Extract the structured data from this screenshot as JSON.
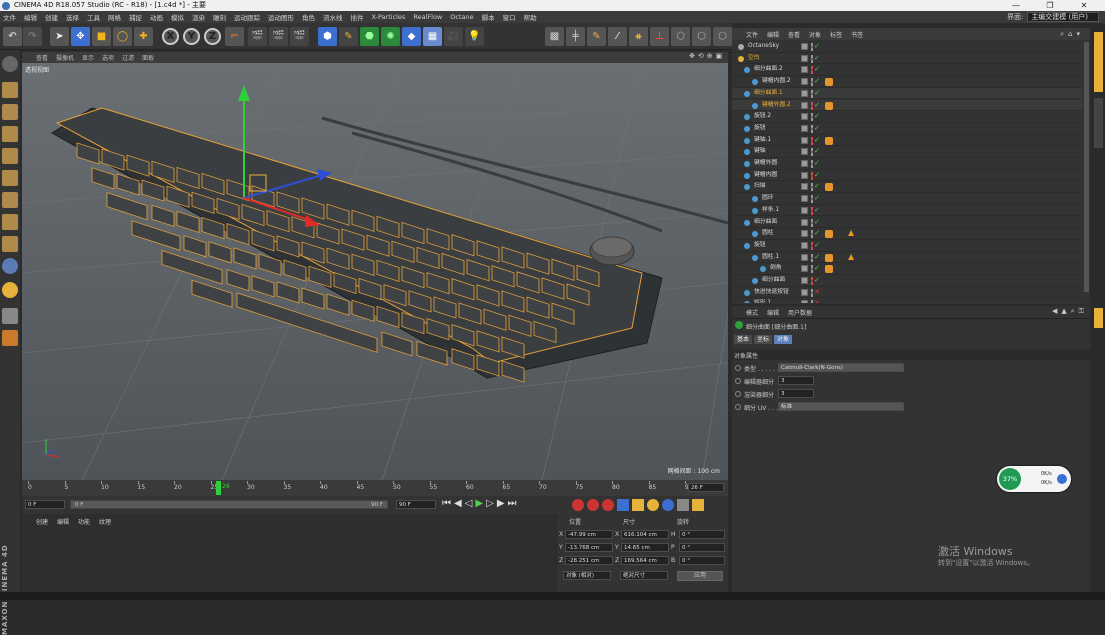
{
  "window": {
    "title": "CINEMA 4D R18.057 Studio (RC - R18) - [1.c4d *] - 主要",
    "btn_min": "—",
    "btn_max": "❐",
    "btn_close": "✕"
  },
  "menubar": [
    "文件",
    "编辑",
    "创建",
    "选择",
    "工具",
    "网格",
    "捕捉",
    "动画",
    "模拟",
    "渲染",
    "雕刻",
    "运动跟踪",
    "运动图形",
    "角色",
    "流水线",
    "插件",
    "X-Particles",
    "RealFlow",
    "Octane",
    "脚本",
    "窗口",
    "帮助"
  ],
  "layout": {
    "label": "界面:",
    "value": "主编交建模 (用户)"
  },
  "toolbar_icons": [
    "undo-icon",
    "redo-icon",
    "select-arrow-icon",
    "move-icon",
    "scale-icon",
    "rotate-icon",
    "live-select-icon",
    "x-axis-icon",
    "y-axis-icon",
    "z-axis-icon",
    "coord-system-icon",
    "render-view-icon",
    "render-picture-icon",
    "render-settings-icon",
    "cube-icon",
    "pen-icon",
    "subdivision-icon",
    "array-icon",
    "floor-icon",
    "deformer-icon",
    "camera-icon",
    "light-icon"
  ],
  "toolbar_axis": {
    "x": "X",
    "y": "Y",
    "z": "Z"
  },
  "viewport": {
    "menu": [
      "查看",
      "摄像机",
      "显示",
      "选项",
      "过滤",
      "面板"
    ],
    "label": "透视视图",
    "grid_spacing": "网格间距 : 100 cm"
  },
  "timeline": {
    "ticks": [
      "0",
      "5",
      "10",
      "15",
      "20",
      "25",
      "30",
      "35",
      "40",
      "45",
      "50",
      "55",
      "60",
      "65",
      "70",
      "75",
      "80",
      "85",
      "90"
    ],
    "current_frame": "26",
    "frame_field": "26 F"
  },
  "transport": {
    "start": "0 F",
    "slider_start": "0 F",
    "slider_end": "90 F",
    "end": "90 F"
  },
  "material_panel": {
    "menu": [
      "创建",
      "编辑",
      "功能",
      "纹理"
    ]
  },
  "brand": {
    "vertical_text": "MAXON CINEMA 4D"
  },
  "coords": {
    "headers": {
      "position": "位置",
      "size": "尺寸",
      "rotation": "旋转"
    },
    "rows": [
      {
        "axis": "X",
        "pos": "-47.99 cm",
        "size_axis": "X",
        "size": "616.104 cm",
        "rot_axis": "H",
        "rot": "0 °"
      },
      {
        "axis": "Y",
        "pos": "-13.768 cm",
        "size_axis": "Y",
        "size": "14.65 cm",
        "rot_axis": "P",
        "rot": "0 °"
      },
      {
        "axis": "Z",
        "pos": "-28.251 cm",
        "size_axis": "Z",
        "size": "169.564 cm",
        "rot_axis": "B",
        "rot": "0 °"
      }
    ],
    "mode1": "对象 (相对)",
    "mode2": "绝对尺寸",
    "apply": "应用"
  },
  "object_manager": {
    "menu": [
      "文件",
      "编辑",
      "查看",
      "对象",
      "标签",
      "书签"
    ],
    "objects": [
      {
        "name": "OctaneSky",
        "color": "#d8d8d8"
      },
      {
        "name": "空白",
        "color": "#e6b23a"
      },
      {
        "name": "细分曲面.2",
        "color": "#d8d8d8"
      },
      {
        "name": "键帽内圆.2",
        "color": "#d8d8d8"
      },
      {
        "name": "细分曲面.1",
        "color": "#e6b23a"
      },
      {
        "name": "键帽外圆.2",
        "color": "#e6b23a"
      },
      {
        "name": "旋钮.2",
        "color": "#d8d8d8"
      },
      {
        "name": "旋钮",
        "color": "#d8d8d8"
      },
      {
        "name": "键轴.1",
        "color": "#d8d8d8"
      },
      {
        "name": "键轴",
        "color": "#d8d8d8"
      },
      {
        "name": "键帽外圆",
        "color": "#d8d8d8"
      },
      {
        "name": "键帽内圆",
        "color": "#d8d8d8"
      },
      {
        "name": "扫描",
        "color": "#d8d8d8"
      },
      {
        "name": "圆环",
        "color": "#d8d8d8"
      },
      {
        "name": "样条.1",
        "color": "#d8d8d8"
      },
      {
        "name": "细分曲面",
        "color": "#d8d8d8"
      },
      {
        "name": "圆柱",
        "color": "#d8d8d8"
      },
      {
        "name": "旋钮",
        "color": "#d8d8d8"
      },
      {
        "name": "圆柱.1",
        "color": "#d8d8d8"
      },
      {
        "name": "倒角",
        "color": "#d8d8d8"
      },
      {
        "name": "细分曲面",
        "color": "#d8d8d8"
      },
      {
        "name": "快进快退按钮",
        "color": "#d8d8d8"
      },
      {
        "name": "矩形.1",
        "color": "#d8d8d8"
      }
    ]
  },
  "attributes": {
    "menu": [
      "模式",
      "编辑",
      "用户数据"
    ],
    "title": "细分曲面 [细分曲面.1]",
    "tabs": [
      "基本",
      "坐标",
      "对象"
    ],
    "section": "对象属性",
    "fields": [
      {
        "label": "类型 . . . . . . . .",
        "value": "Catmull-Clark(N-Gons)"
      },
      {
        "label": "编辑器细分",
        "value": "3"
      },
      {
        "label": "渲染器细分",
        "value": "3"
      },
      {
        "label": "细分 UV . . . . .",
        "value": "标准"
      }
    ]
  },
  "netmon": {
    "percent": "37%",
    "up": "0K/s",
    "down": "0K/s"
  },
  "watermark": {
    "line1": "激活 Windows",
    "line2": "转到\"设置\"以激活 Windows。"
  },
  "colors": {
    "accent": "#e6b23a",
    "select_blue": "#2e6fd4",
    "green_axis": "#2fd13a",
    "red_axis": "#e02a2a"
  }
}
